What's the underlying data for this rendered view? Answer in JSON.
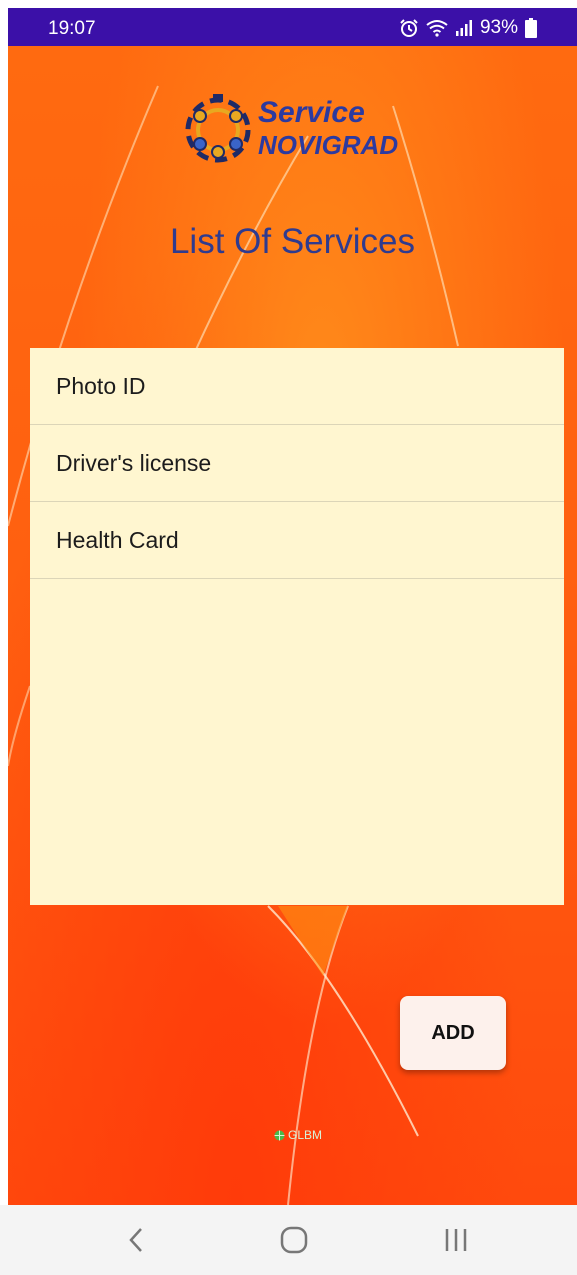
{
  "status_bar": {
    "time": "19:07",
    "battery": "93%",
    "icons": [
      "alarm-icon",
      "wifi-icon",
      "signal-icon",
      "battery-icon"
    ]
  },
  "logo": {
    "line1": "Service",
    "line2": "NOVIGRAD"
  },
  "page": {
    "title": "List Of Services"
  },
  "services": [
    {
      "label": "Photo ID"
    },
    {
      "label": "Driver's license"
    },
    {
      "label": "Health Card"
    }
  ],
  "actions": {
    "add_label": "ADD"
  },
  "watermark": {
    "text": "GLBM"
  },
  "nav_bar": {
    "icons": [
      "back-icon",
      "home-icon",
      "recents-icon"
    ]
  },
  "colors": {
    "status_bar": "#3b10a8",
    "background": "#ff6010",
    "title": "#2f3b8f",
    "list_panel": "#fff6d0",
    "add_button": "#fdf1ec"
  }
}
